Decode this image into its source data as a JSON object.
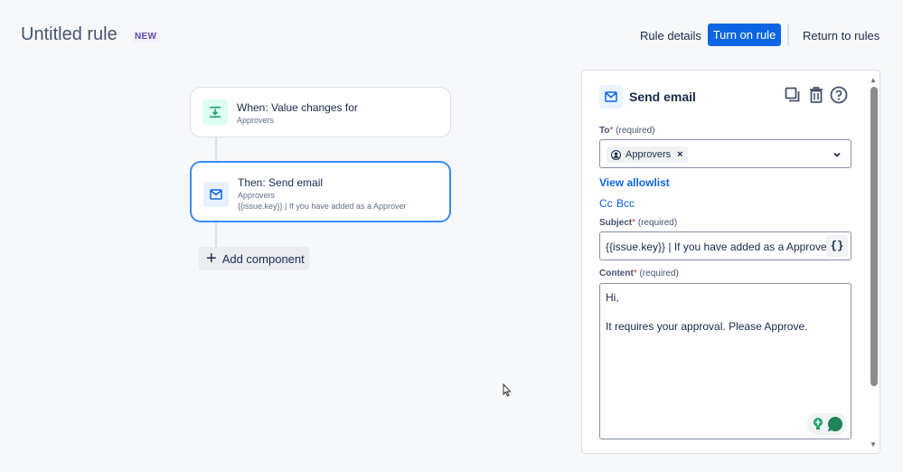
{
  "header": {
    "title": "Untitled rule",
    "badge": "NEW",
    "rule_details": "Rule details",
    "turn_on": "Turn on rule",
    "return": "Return to rules"
  },
  "canvas": {
    "trigger": {
      "title": "When: Value changes for",
      "subtitle": "Approvers",
      "icon": "value-changes-icon"
    },
    "action": {
      "title": "Then: Send email",
      "subtitle": "Approvers",
      "detail": "{{issue.key}} | If you have added as a Approver",
      "icon": "email-icon"
    },
    "add_component": "Add component"
  },
  "panel": {
    "title": "Send email",
    "icons": [
      "duplicate-icon",
      "delete-icon",
      "help-icon"
    ],
    "to": {
      "label": "To",
      "required": "(required)",
      "chip": "Approvers"
    },
    "view_allowlist": "View allowlist",
    "cc": "Cc",
    "bcc": "Bcc",
    "subject": {
      "label": "Subject",
      "required": "(required)",
      "value": "{{issue.key}} | If you have added as a Approver",
      "smart_values": "{}"
    },
    "content": {
      "label": "Content",
      "required": "(required)",
      "line1": "Hi,",
      "line2": "It requires your approval. Please Approve."
    }
  },
  "colors": {
    "primary": "#0c66e4",
    "selected_border": "#388bff",
    "badge_text": "#5e4db2",
    "required_star": "#c9372c"
  }
}
